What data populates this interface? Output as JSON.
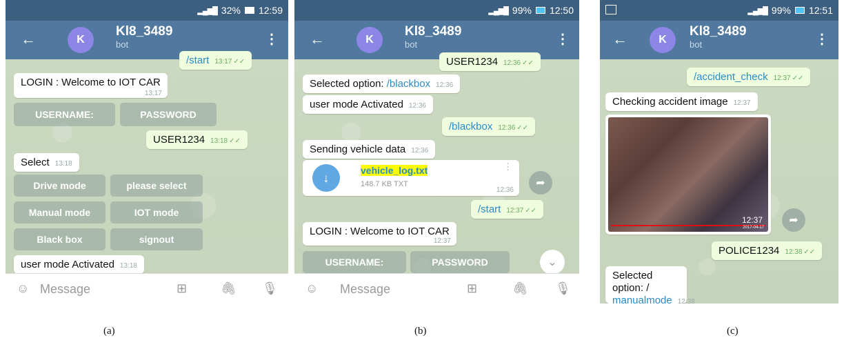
{
  "panels": {
    "a": {
      "status_battery": "32%",
      "status_time": "12:59",
      "caption": "(a)"
    },
    "b": {
      "status_battery": "99%",
      "status_time": "12:50",
      "caption": "(b)"
    },
    "c": {
      "status_battery": "99%",
      "status_time": "12:51",
      "caption": "(c)"
    }
  },
  "chat": {
    "title": "Kl8_3489",
    "subtitle": "bot",
    "avatar_letter": "K",
    "input_placeholder": "Message"
  },
  "a": {
    "m1": {
      "text": "/start",
      "time": "13:17"
    },
    "m2": {
      "text": "LOGIN : Welcome to IOT CAR",
      "time": "13:17"
    },
    "kb1": [
      "USERNAME:",
      "PASSWORD"
    ],
    "m3": {
      "text": "USER1234",
      "time": "13:18"
    },
    "m4": {
      "text": "Select",
      "time": "13:18"
    },
    "kb2": [
      "Drive mode",
      "please select",
      "Manual mode",
      "IOT mode",
      "Black box",
      "signout"
    ],
    "m5": {
      "text": "user mode Activated",
      "time": "13:18"
    }
  },
  "b": {
    "m1": {
      "text": "USER1234",
      "time": "12:36"
    },
    "m2": {
      "prefix": "Selected option: ",
      "cmd": "/blackbox",
      "time": "12:36"
    },
    "m3": {
      "text": "user mode Activated",
      "time": "12:36"
    },
    "m4": {
      "text": "/blackbox",
      "time": "12:36"
    },
    "m5": {
      "text": "Sending vehicle data",
      "time": "12:36"
    },
    "file": {
      "name": "vehicle_log.txt",
      "size": "148.7 KB TXT",
      "time": "12:36"
    },
    "m6": {
      "text": "/start",
      "time": "12:37"
    },
    "m7": {
      "text": "LOGIN : Welcome to IOT CAR",
      "time": "12:37"
    },
    "kb": [
      "USERNAME:",
      "PASSWORD"
    ]
  },
  "c": {
    "m1": {
      "text": "/accident_check",
      "time": "12:37"
    },
    "m2": {
      "text": "Checking accident image",
      "time": "12:37"
    },
    "photo": {
      "time": "12:37",
      "stamp": "2017-04-17"
    },
    "m3": {
      "text": "POLICE1234",
      "time": "12:38"
    },
    "m4": {
      "prefix": "Selected option: /",
      "cmd": "manualmode",
      "time": "12:38"
    }
  },
  "colors": {
    "appbar": "#51799f",
    "statusbar": "#3c5f7f",
    "avatar": "#8e86e6",
    "outgoing": "#effdde",
    "link": "#2a8cc6",
    "highlight": "#ffff00"
  }
}
